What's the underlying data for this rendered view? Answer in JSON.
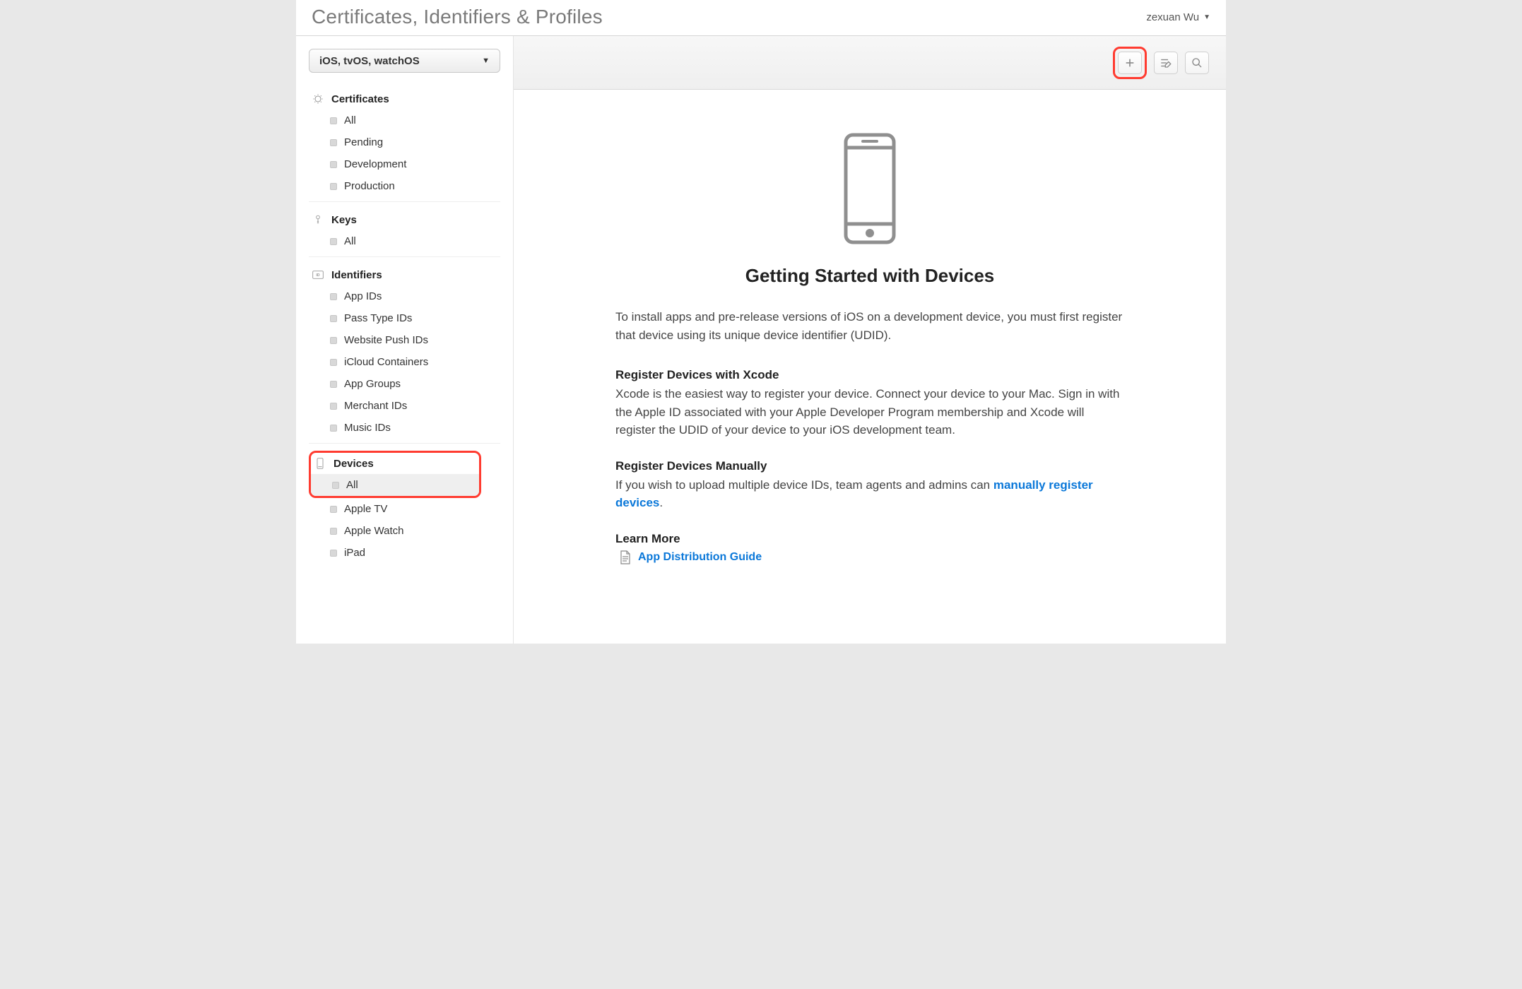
{
  "header": {
    "title": "Certificates, Identifiers & Profiles",
    "user_name": "zexuan Wu"
  },
  "sidebar": {
    "platform_label": "iOS, tvOS, watchOS",
    "groups": {
      "certificates": {
        "title": "Certificates",
        "items": [
          "All",
          "Pending",
          "Development",
          "Production"
        ]
      },
      "keys": {
        "title": "Keys",
        "items": [
          "All"
        ]
      },
      "identifiers": {
        "title": "Identifiers",
        "items": [
          "App IDs",
          "Pass Type IDs",
          "Website Push IDs",
          "iCloud Containers",
          "App Groups",
          "Merchant IDs",
          "Music IDs"
        ]
      },
      "devices": {
        "title": "Devices",
        "items": [
          "All",
          "Apple TV",
          "Apple Watch",
          "iPad"
        ]
      }
    }
  },
  "content": {
    "heading": "Getting Started with Devices",
    "intro": "To install apps and pre-release versions of iOS on a development device, you must first register that device using its unique device identifier (UDID).",
    "section1_title": "Register Devices with Xcode",
    "section1_body": "Xcode is the easiest way to register your device. Connect your device to your Mac. Sign in with the Apple ID associated with your Apple Developer Program membership and Xcode will register the UDID of your device to your iOS development team.",
    "section2_title": "Register Devices Manually",
    "section2_body_prefix": "If you wish to upload multiple device IDs, team agents and admins can ",
    "section2_link": "manually register devices",
    "section2_body_suffix": ".",
    "learn_more_title": "Learn More",
    "learn_more_link": "App Distribution Guide"
  }
}
